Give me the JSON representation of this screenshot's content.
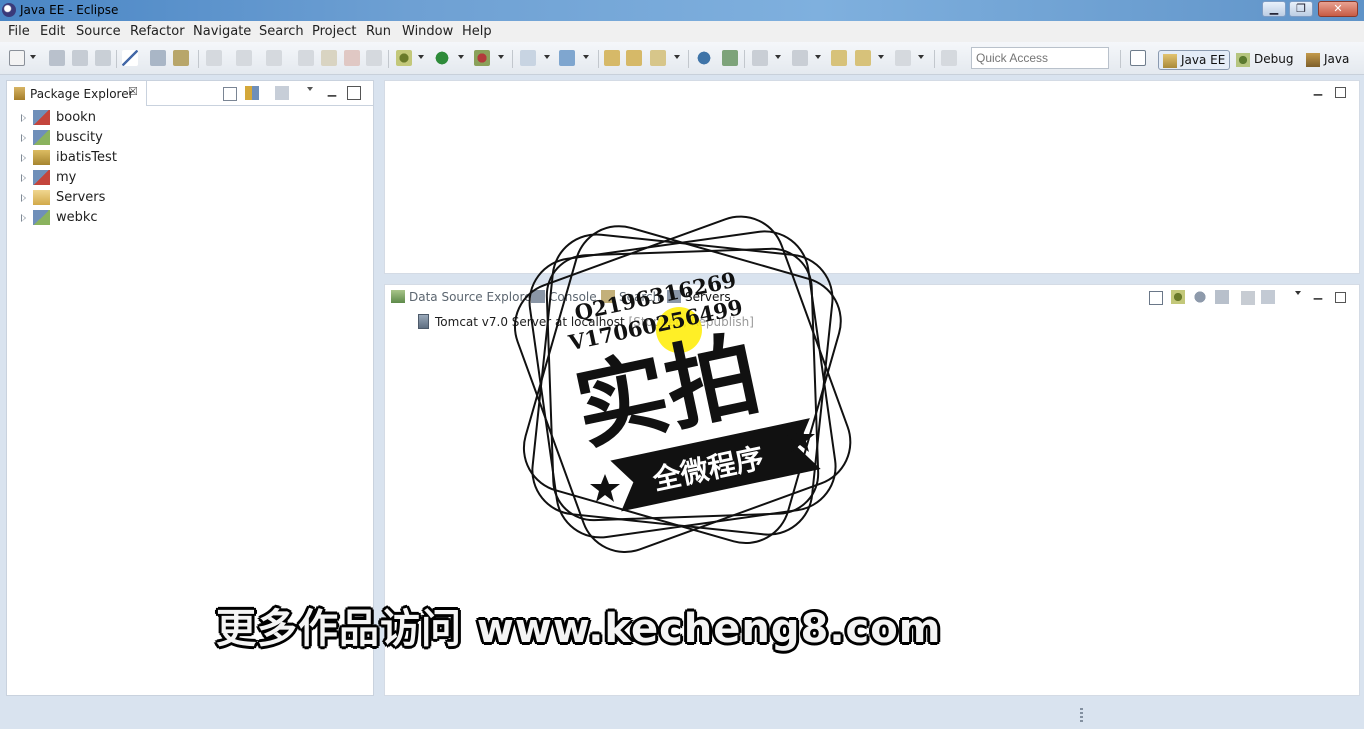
{
  "window": {
    "title": "Java EE - Eclipse",
    "minimize_glyph": "▁",
    "restore_glyph": "❐",
    "close_glyph": "✕"
  },
  "menu": [
    "File",
    "Edit",
    "Source",
    "Refactor",
    "Navigate",
    "Search",
    "Project",
    "Run",
    "Window",
    "Help"
  ],
  "toolbar": {
    "quick_access_placeholder": "Quick Access",
    "perspectives": [
      {
        "label": "Java EE",
        "active": true,
        "icon": "java-ee-perspective-icon"
      },
      {
        "label": "Debug",
        "active": false,
        "icon": "debug-perspective-icon"
      },
      {
        "label": "Java",
        "active": false,
        "icon": "java-perspective-icon"
      }
    ]
  },
  "package_explorer": {
    "tab_label": "Package Explorer",
    "tab_close": "☒",
    "projects": [
      {
        "name": "bookn",
        "icon": "web-project-error-icon"
      },
      {
        "name": "buscity",
        "icon": "web-project-icon"
      },
      {
        "name": "ibatisTest",
        "icon": "java-project-icon"
      },
      {
        "name": "my",
        "icon": "web-project-error-icon"
      },
      {
        "name": "Servers",
        "icon": "folder-icon"
      },
      {
        "name": "webkc",
        "icon": "web-project-icon"
      }
    ]
  },
  "bottom_views": {
    "tabs": [
      {
        "label": "Data Source Explorer",
        "icon": "database-icon"
      },
      {
        "label": "Console",
        "icon": "console-icon"
      },
      {
        "label": "Search",
        "icon": "search-icon"
      },
      {
        "label": "Servers",
        "icon": "servers-icon",
        "active": true
      }
    ],
    "server": {
      "name": "Tomcat v7.0 Server at localhost",
      "status": "[Stopped, Republish]"
    }
  },
  "watermark": {
    "line1": "Q2196316269",
    "line2": "V17060256499",
    "big": "实拍",
    "banner": "全微程序",
    "url": "更多作品访问 www.kecheng8.com"
  },
  "colors": {
    "titlebar": "#5f93c8",
    "background": "#d9e3ef",
    "panel": "#ffffff"
  }
}
